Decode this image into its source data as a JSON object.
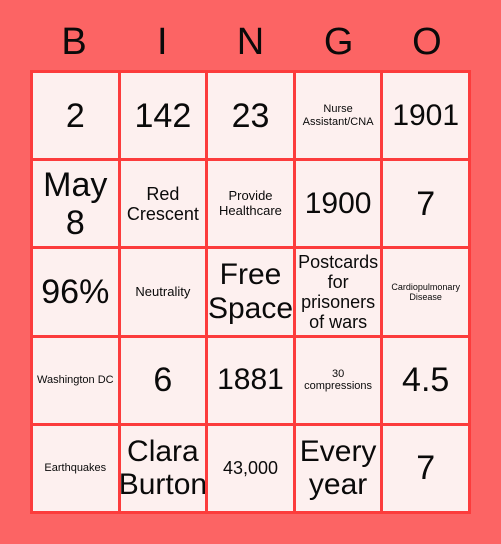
{
  "card": {
    "title_letters": [
      "B",
      "I",
      "N",
      "G",
      "O"
    ],
    "colors": {
      "background": "#fc6464",
      "grid_line": "#fc3c3c",
      "cell_background": "#fdf0ef",
      "text": "#0a0a0a"
    },
    "rows": [
      [
        {
          "text": "2",
          "size": "sz-xl"
        },
        {
          "text": "142",
          "size": "sz-xl"
        },
        {
          "text": "23",
          "size": "sz-xl"
        },
        {
          "text": "Nurse Assistant/CNA",
          "size": "sz-xs"
        },
        {
          "text": "1901",
          "size": "sz-lg"
        }
      ],
      [
        {
          "text": "May 8",
          "size": "sz-xl"
        },
        {
          "text": "Red Crescent",
          "size": "sz-md"
        },
        {
          "text": "Provide Healthcare",
          "size": "sz-sm"
        },
        {
          "text": "1900",
          "size": "sz-lg"
        },
        {
          "text": "7",
          "size": "sz-xl"
        }
      ],
      [
        {
          "text": "96%",
          "size": "sz-xl"
        },
        {
          "text": "Neutrality",
          "size": "sz-sm"
        },
        {
          "text": "Free Space",
          "size": "sz-lg"
        },
        {
          "text": "Postcards for prisoners of wars",
          "size": "sz-md"
        },
        {
          "text": "Cardiopulmonary Disease",
          "size": "sz-xxs"
        }
      ],
      [
        {
          "text": "Washington DC",
          "size": "sz-xs"
        },
        {
          "text": "6",
          "size": "sz-xl"
        },
        {
          "text": "1881",
          "size": "sz-lg"
        },
        {
          "text": "30 compressions",
          "size": "sz-xs"
        },
        {
          "text": "4.5",
          "size": "sz-xl"
        }
      ],
      [
        {
          "text": "Earthquakes",
          "size": "sz-xs"
        },
        {
          "text": "Clara Burton",
          "size": "sz-lg"
        },
        {
          "text": "43,000",
          "size": "sz-md"
        },
        {
          "text": "Every year",
          "size": "sz-lg"
        },
        {
          "text": "7",
          "size": "sz-xl"
        }
      ]
    ]
  }
}
